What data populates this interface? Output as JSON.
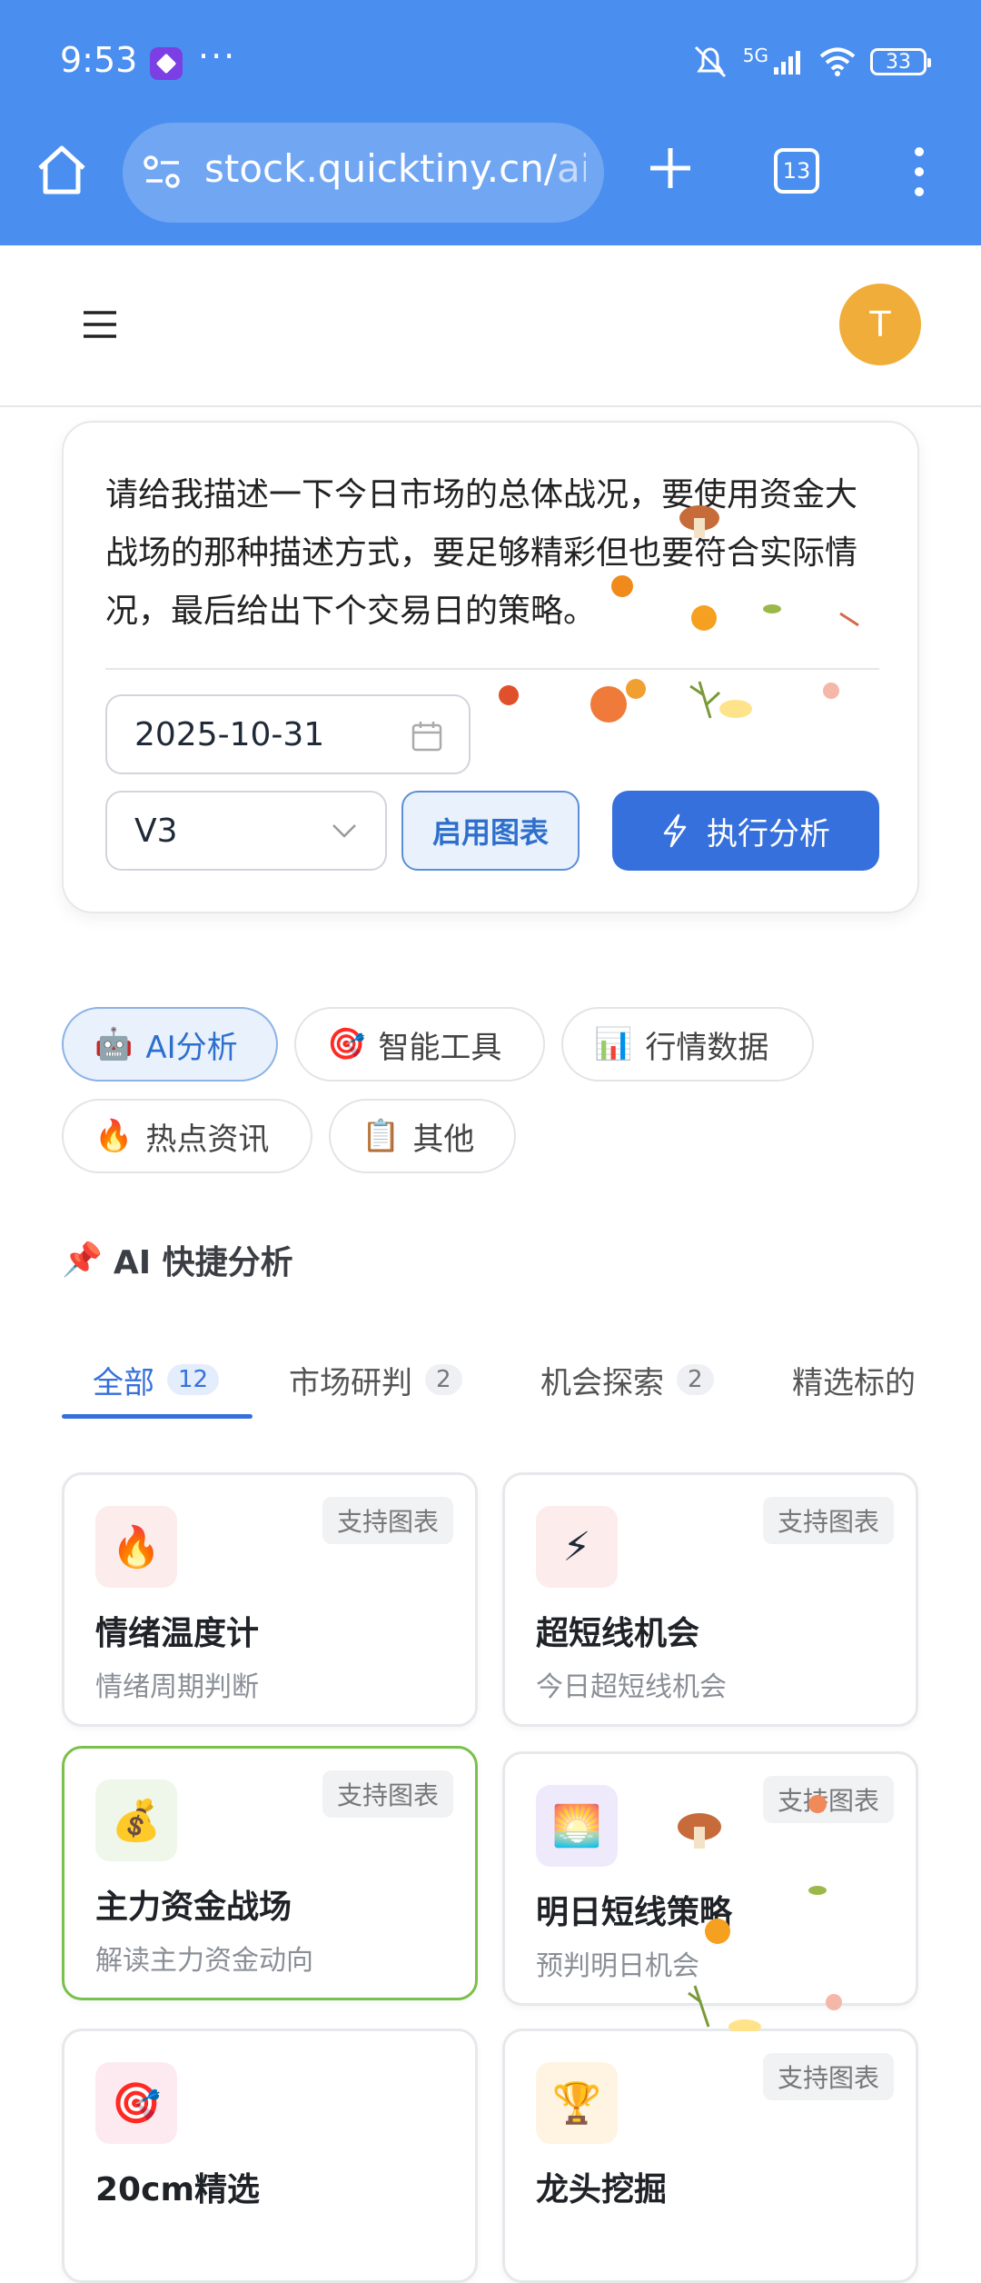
{
  "status_bar": {
    "time": "9:53",
    "dots": "···",
    "network": "5G",
    "battery": "33"
  },
  "browser": {
    "url_main": "stock.quicktiny.cn/",
    "url_dim": "ai",
    "tab_count": "13"
  },
  "appbar": {
    "avatar_letter": "T"
  },
  "prompt": {
    "text": "请给我描述一下今日市场的总体战况，要使用资金大战场的那种描述方式，要足够精彩但也要符合实际情况，最后给出下个交易日的策略。",
    "date": "2025-10-31",
    "model": "V3",
    "chart_toggle": "启用图表",
    "run_label": "执行分析"
  },
  "categories": [
    {
      "emoji": "🤖",
      "label": "AI分析"
    },
    {
      "emoji": "🎯",
      "label": "智能工具"
    },
    {
      "emoji": "📊",
      "label": "行情数据"
    },
    {
      "emoji": "🔥",
      "label": "热点资讯"
    },
    {
      "emoji": "📋",
      "label": "其他"
    }
  ],
  "section": {
    "emoji": "📌",
    "title": "AI 快捷分析"
  },
  "subtabs": [
    {
      "label": "全部",
      "count": "12"
    },
    {
      "label": "市场研判",
      "count": "2"
    },
    {
      "label": "机会探索",
      "count": "2"
    },
    {
      "label": "精选标的",
      "count": ""
    }
  ],
  "cards": [
    {
      "emoji": "🔥",
      "title": "情绪温度计",
      "subtitle": "情绪周期判断",
      "badge": "支持图表",
      "icon_bg": "#fdecec"
    },
    {
      "emoji": "⚡",
      "title": "超短线机会",
      "subtitle": "今日超短线机会",
      "badge": "支持图表",
      "icon_bg": "#fdecec"
    },
    {
      "emoji": "💰",
      "title": "主力资金战场",
      "subtitle": "解读主力资金动向",
      "badge": "支持图表",
      "icon_bg": "#eef7ea"
    },
    {
      "emoji": "🌅",
      "title": "明日短线策略",
      "subtitle": "预判明日机会",
      "badge": "支持图表",
      "icon_bg": "#efeafb"
    },
    {
      "emoji": "🎯",
      "title": "20cm精选",
      "subtitle": "",
      "badge": "",
      "icon_bg": "#fdeaf0"
    },
    {
      "emoji": "🏆",
      "title": "龙头挖掘",
      "subtitle": "",
      "badge": "支持图表",
      "icon_bg": "#fff4e2"
    }
  ]
}
